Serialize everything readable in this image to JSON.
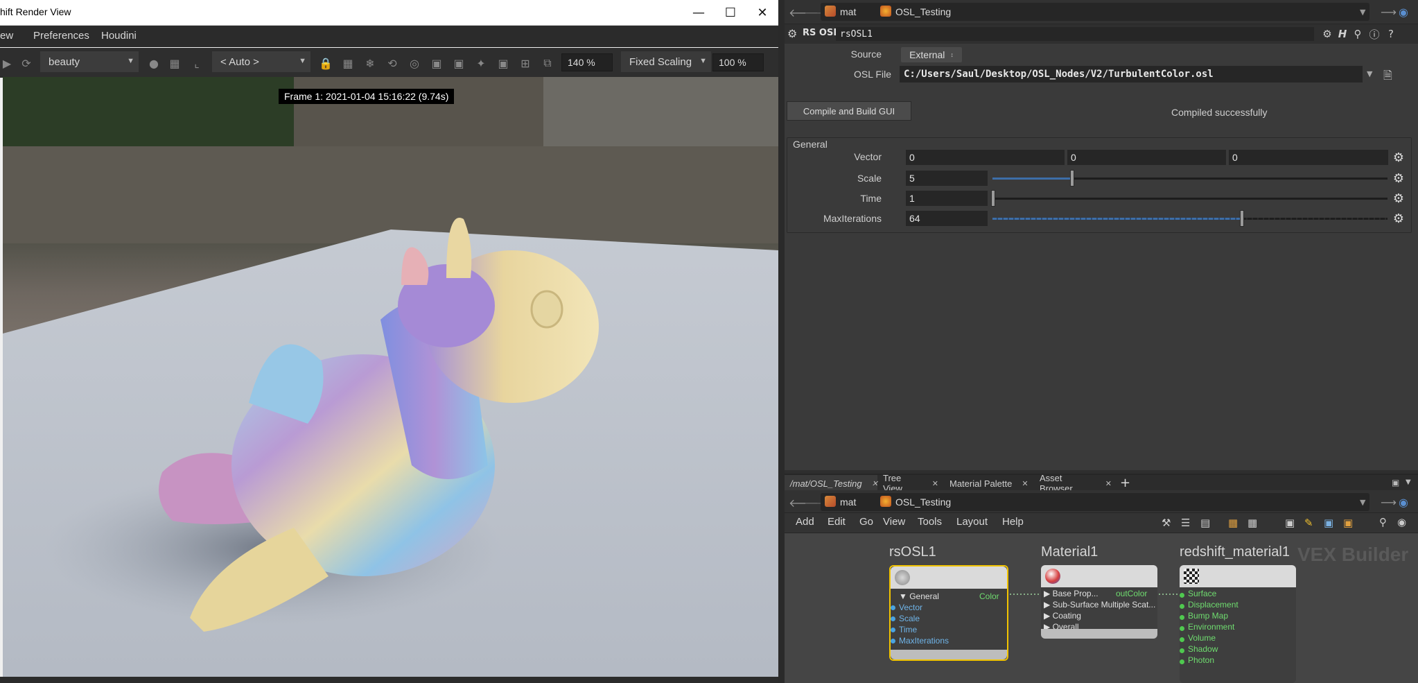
{
  "render_view": {
    "title": "hift Render View",
    "menu": [
      "ew",
      "Preferences",
      "Houdini"
    ],
    "aov": "beauty",
    "camera_mode": "< Auto >",
    "zoom": "140 %",
    "scaling_mode": "Fixed Scaling",
    "scaling_value": "100 %",
    "frame_info": "Frame  1: 2021-01-04  15:16:22  (9.74s)"
  },
  "parm_path": {
    "crumb_root": "mat",
    "crumb_node": "OSL_Testing"
  },
  "parm": {
    "node_type": "RS OSL",
    "node_name": "rsOSL1",
    "source_label": "Source",
    "source_value": "External",
    "osl_file_label": "OSL File",
    "osl_file_value": "C:/Users/Saul/Desktop/OSL_Nodes/V2/TurbulentColor.osl",
    "compile_button": "Compile and Build GUI",
    "compile_status": "Compiled successfully",
    "folder_label": "General",
    "vector_label": "Vector",
    "vector_values": [
      "0",
      "0",
      "0"
    ],
    "scale_label": "Scale",
    "scale_value": "5",
    "time_label": "Time",
    "time_value": "1",
    "maxiter_label": "MaxIterations",
    "maxiter_value": "64",
    "scale_slider_fraction": 0.2,
    "time_slider_fraction": 0.0,
    "maxiter_slider_fraction": 0.63
  },
  "tabs": [
    "/mat/OSL_Testing",
    "Tree View",
    "Material Palette",
    "Asset Browser"
  ],
  "net_path": {
    "crumb_root": "mat",
    "crumb_node": "OSL_Testing"
  },
  "net_menu": [
    "Add",
    "Edit",
    "Go",
    "View",
    "Tools",
    "Layout",
    "Help"
  ],
  "network": {
    "context_title": "VEX Builder",
    "nodes": {
      "rsosl": {
        "name": "rsOSL1",
        "inputs": [
          "General",
          "Vector",
          "Scale",
          "Time",
          "MaxIterations"
        ],
        "output": "Color"
      },
      "material": {
        "name": "Material1",
        "inputs": [
          "Base Prop...",
          "Sub-Surface Multiple Scat...",
          "Coating",
          "Overall"
        ],
        "output": "outColor"
      },
      "redshift": {
        "name": "redshift_material1",
        "inputs": [
          "Surface",
          "Displacement",
          "Bump Map",
          "Environment",
          "Volume",
          "Shadow",
          "Photon"
        ]
      }
    }
  },
  "colors": {
    "selected_node": "#f2c400",
    "input_port": "#4aa3e0",
    "material_port": "#4fc94f"
  }
}
